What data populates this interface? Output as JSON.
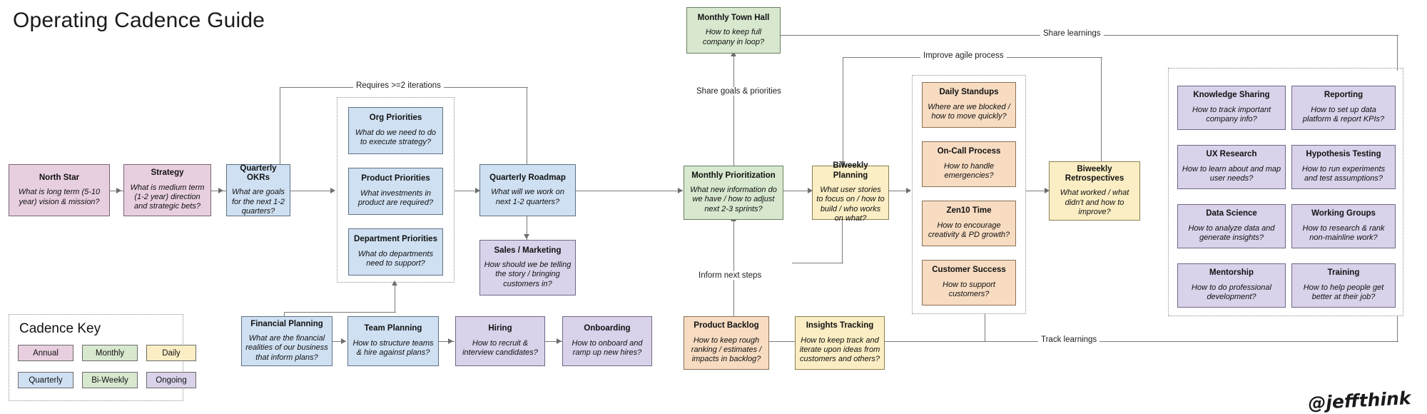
{
  "page": {
    "title": "Operating Cadence Guide",
    "signature": "@jeffthink"
  },
  "legend": {
    "heading": "Cadence Key",
    "chips": [
      {
        "label": "Annual",
        "color": "#e8cfe0"
      },
      {
        "label": "Monthly",
        "color": "#d7e8cf"
      },
      {
        "label": "Daily",
        "color": "#fbeec4"
      },
      {
        "label": "Quarterly",
        "color": "#cfe0f2"
      },
      {
        "label": "Bi-Weekly",
        "color": "#d7e8cf"
      },
      {
        "label": "Ongoing",
        "color": "#d9d2ea"
      }
    ]
  },
  "nodes": {
    "north_star": {
      "title": "North Star",
      "desc": "What is long term (5-10 year) vision & mission?"
    },
    "strategy": {
      "title": "Strategy",
      "desc": "What is medium term (1-2 year) direction and strategic bets?"
    },
    "quarterly_okrs": {
      "title": "Quarterly OKRs",
      "desc": "What are goals for the next 1-2 quarters?"
    },
    "org_priorities": {
      "title": "Org Priorities",
      "desc": "What do we need to do to execute strategy?"
    },
    "product_priorities": {
      "title": "Product Priorities",
      "desc": "What investments in product are required?"
    },
    "dept_priorities": {
      "title": "Department Priorities",
      "desc": "What do departments need to support?"
    },
    "quarterly_roadmap": {
      "title": "Quarterly Roadmap",
      "desc": "What will we work on next 1-2 quarters?"
    },
    "sales_marketing": {
      "title": "Sales / Marketing",
      "desc": "How should we be telling the story / bringing customers in?"
    },
    "monthly_town_hall": {
      "title": "Monthly Town Hall",
      "desc": "How to keep full company in loop?"
    },
    "monthly_prior": {
      "title": "Monthly Prioritization",
      "desc": "What new information do we have / how to adjust next 2-3 sprints?"
    },
    "biweekly_planning": {
      "title": "Biweekly Planning",
      "desc": "What user stories to focus on / how to build / who works on what?"
    },
    "biweekly_retros": {
      "title": "Biweekly Retrospectives",
      "desc": "What worked / what didn't and how to improve?"
    },
    "daily_standups": {
      "title": "Daily Standups",
      "desc": "Where are we blocked / how to move quickly?"
    },
    "oncall_process": {
      "title": "On-Call Process",
      "desc": "How to handle emergencies?"
    },
    "zen10_time": {
      "title": "Zen10 Time",
      "desc": "How to encourage creativity & PD growth?"
    },
    "customer_success": {
      "title": "Customer Success",
      "desc": "How to support customers?"
    },
    "knowledge_sharing": {
      "title": "Knowledge Sharing",
      "desc": "How to track important company info?"
    },
    "reporting": {
      "title": "Reporting",
      "desc": "How to set up data platform & report KPIs?"
    },
    "ux_research": {
      "title": "UX Research",
      "desc": "How to learn about and map user needs?"
    },
    "hypothesis_testing": {
      "title": "Hypothesis Testing",
      "desc": "How to run experiments and test assumptions?"
    },
    "data_science": {
      "title": "Data Science",
      "desc": "How to analyze data and generate insights?"
    },
    "working_groups": {
      "title": "Working Groups",
      "desc": "How to research & rank non-mainline work?"
    },
    "mentorship": {
      "title": "Mentorship",
      "desc": "How to do professional development?"
    },
    "training": {
      "title": "Training",
      "desc": "How to help people get better at their job?"
    },
    "financial_planning": {
      "title": "Financial Planning",
      "desc": "What are the financial realities of our business that inform plans?"
    },
    "team_planning": {
      "title": "Team Planning",
      "desc": "How to structure teams & hire against plans?"
    },
    "hiring": {
      "title": "Hiring",
      "desc": "How to recruit & interview candidates?"
    },
    "onboarding": {
      "title": "Onboarding",
      "desc": "How to onboard and ramp up new hires?"
    },
    "product_backlog": {
      "title": "Product Backlog",
      "desc": "How to keep rough ranking / estimates / impacts in backlog?"
    },
    "insights_tracking": {
      "title": "Insights Tracking",
      "desc": "How to keep track and iterate upon ideas from customers and others?"
    }
  },
  "edge_labels": {
    "requires_iterations": "Requires >=2 iterations",
    "share_goals": "Share goals & priorities",
    "share_learnings": "Share learnings",
    "improve_agile": "Improve agile process",
    "inform_next_steps": "Inform next steps",
    "track_learnings": "Track learnings"
  }
}
